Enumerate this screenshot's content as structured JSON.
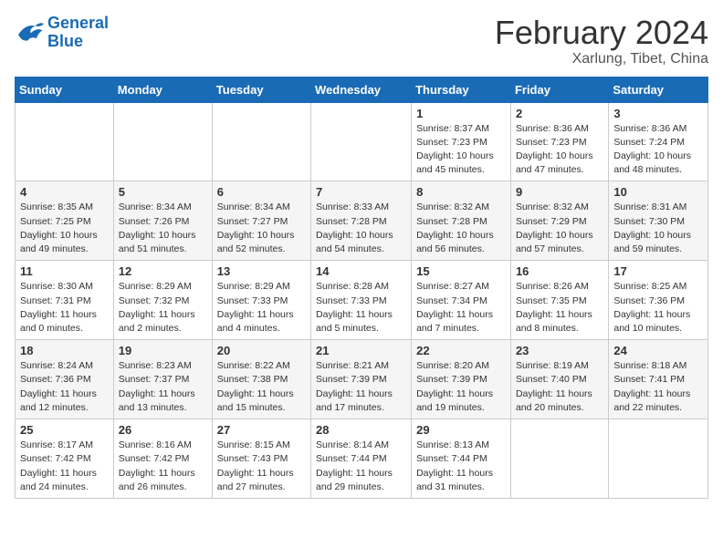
{
  "header": {
    "logo_line1": "General",
    "logo_line2": "Blue",
    "main_title": "February 2024",
    "subtitle": "Xarlung, Tibet, China"
  },
  "weekdays": [
    "Sunday",
    "Monday",
    "Tuesday",
    "Wednesday",
    "Thursday",
    "Friday",
    "Saturday"
  ],
  "weeks": [
    [
      {
        "day": "",
        "info": ""
      },
      {
        "day": "",
        "info": ""
      },
      {
        "day": "",
        "info": ""
      },
      {
        "day": "",
        "info": ""
      },
      {
        "day": "1",
        "info": "Sunrise: 8:37 AM\nSunset: 7:23 PM\nDaylight: 10 hours and 45 minutes."
      },
      {
        "day": "2",
        "info": "Sunrise: 8:36 AM\nSunset: 7:23 PM\nDaylight: 10 hours and 47 minutes."
      },
      {
        "day": "3",
        "info": "Sunrise: 8:36 AM\nSunset: 7:24 PM\nDaylight: 10 hours and 48 minutes."
      }
    ],
    [
      {
        "day": "4",
        "info": "Sunrise: 8:35 AM\nSunset: 7:25 PM\nDaylight: 10 hours and 49 minutes."
      },
      {
        "day": "5",
        "info": "Sunrise: 8:34 AM\nSunset: 7:26 PM\nDaylight: 10 hours and 51 minutes."
      },
      {
        "day": "6",
        "info": "Sunrise: 8:34 AM\nSunset: 7:27 PM\nDaylight: 10 hours and 52 minutes."
      },
      {
        "day": "7",
        "info": "Sunrise: 8:33 AM\nSunset: 7:28 PM\nDaylight: 10 hours and 54 minutes."
      },
      {
        "day": "8",
        "info": "Sunrise: 8:32 AM\nSunset: 7:28 PM\nDaylight: 10 hours and 56 minutes."
      },
      {
        "day": "9",
        "info": "Sunrise: 8:32 AM\nSunset: 7:29 PM\nDaylight: 10 hours and 57 minutes."
      },
      {
        "day": "10",
        "info": "Sunrise: 8:31 AM\nSunset: 7:30 PM\nDaylight: 10 hours and 59 minutes."
      }
    ],
    [
      {
        "day": "11",
        "info": "Sunrise: 8:30 AM\nSunset: 7:31 PM\nDaylight: 11 hours and 0 minutes."
      },
      {
        "day": "12",
        "info": "Sunrise: 8:29 AM\nSunset: 7:32 PM\nDaylight: 11 hours and 2 minutes."
      },
      {
        "day": "13",
        "info": "Sunrise: 8:29 AM\nSunset: 7:33 PM\nDaylight: 11 hours and 4 minutes."
      },
      {
        "day": "14",
        "info": "Sunrise: 8:28 AM\nSunset: 7:33 PM\nDaylight: 11 hours and 5 minutes."
      },
      {
        "day": "15",
        "info": "Sunrise: 8:27 AM\nSunset: 7:34 PM\nDaylight: 11 hours and 7 minutes."
      },
      {
        "day": "16",
        "info": "Sunrise: 8:26 AM\nSunset: 7:35 PM\nDaylight: 11 hours and 8 minutes."
      },
      {
        "day": "17",
        "info": "Sunrise: 8:25 AM\nSunset: 7:36 PM\nDaylight: 11 hours and 10 minutes."
      }
    ],
    [
      {
        "day": "18",
        "info": "Sunrise: 8:24 AM\nSunset: 7:36 PM\nDaylight: 11 hours and 12 minutes."
      },
      {
        "day": "19",
        "info": "Sunrise: 8:23 AM\nSunset: 7:37 PM\nDaylight: 11 hours and 13 minutes."
      },
      {
        "day": "20",
        "info": "Sunrise: 8:22 AM\nSunset: 7:38 PM\nDaylight: 11 hours and 15 minutes."
      },
      {
        "day": "21",
        "info": "Sunrise: 8:21 AM\nSunset: 7:39 PM\nDaylight: 11 hours and 17 minutes."
      },
      {
        "day": "22",
        "info": "Sunrise: 8:20 AM\nSunset: 7:39 PM\nDaylight: 11 hours and 19 minutes."
      },
      {
        "day": "23",
        "info": "Sunrise: 8:19 AM\nSunset: 7:40 PM\nDaylight: 11 hours and 20 minutes."
      },
      {
        "day": "24",
        "info": "Sunrise: 8:18 AM\nSunset: 7:41 PM\nDaylight: 11 hours and 22 minutes."
      }
    ],
    [
      {
        "day": "25",
        "info": "Sunrise: 8:17 AM\nSunset: 7:42 PM\nDaylight: 11 hours and 24 minutes."
      },
      {
        "day": "26",
        "info": "Sunrise: 8:16 AM\nSunset: 7:42 PM\nDaylight: 11 hours and 26 minutes."
      },
      {
        "day": "27",
        "info": "Sunrise: 8:15 AM\nSunset: 7:43 PM\nDaylight: 11 hours and 27 minutes."
      },
      {
        "day": "28",
        "info": "Sunrise: 8:14 AM\nSunset: 7:44 PM\nDaylight: 11 hours and 29 minutes."
      },
      {
        "day": "29",
        "info": "Sunrise: 8:13 AM\nSunset: 7:44 PM\nDaylight: 11 hours and 31 minutes."
      },
      {
        "day": "",
        "info": ""
      },
      {
        "day": "",
        "info": ""
      }
    ]
  ]
}
